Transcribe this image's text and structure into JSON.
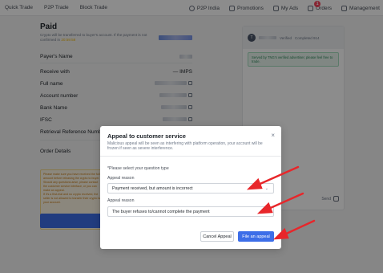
{
  "topnav": {
    "left": [
      "Quick Trade",
      "P2P Trade",
      "Block Trade"
    ],
    "right": [
      {
        "label": "P2P India",
        "icon": "globe-icon"
      },
      {
        "label": "Promotions",
        "icon": "gift-icon"
      },
      {
        "label": "My Ads",
        "icon": "list-icon"
      },
      {
        "label": "Orders",
        "icon": "order-icon",
        "badge": "1"
      },
      {
        "label": "Management",
        "icon": "more-icon"
      }
    ]
  },
  "order": {
    "status": "Paid",
    "subtitle": "Crypto will be transferred to buyer's account. If the payment is not confirmed in",
    "timer": "20:59:58",
    "payer_label": "Payer's Name",
    "receive_label": "Receive with",
    "receive_value": "IMPS",
    "fields": [
      "Full name",
      "Account number",
      "Bank Name",
      "IFSC",
      "Retrieval Reference Number"
    ],
    "details_label": "Order Details",
    "warning_lines": [
      "Please make sure you have received the full amount before releasing the crypto to buyer.",
      "Should any questions arise, please contact the customer service interface, or you can make an appeal.",
      "If it's a first-trial and no crypto received, the seller is not allowed to transfer their crypto to your account."
    ],
    "pay_button": "Payment r"
  },
  "chat": {
    "avatar_letter": "T",
    "verified": "Verified",
    "completed": "Completed 914",
    "notice": "Served by TNG's verified advertiser, please feel free to trade.",
    "send": "Send"
  },
  "modal": {
    "title": "Appeal to customer service",
    "close": "×",
    "description": "Malicious appeal will be seen as interfering with platform operation, your account will be frozen if seen as severe interference.",
    "question_prompt": "*Please select your question type",
    "reason1_label": "Appeal reason",
    "reason1_value": "Payment received, but amount is incorrect",
    "reason2_label": "Appeal reason",
    "reason2_value": "The buyer refuses to/cannot complete the payment",
    "cancel_label": "Cancel Appeal",
    "submit_label": "File an appeal"
  },
  "colors": {
    "accent": "#3d6ee8",
    "arrow": "#e8262a",
    "warning": "#f0b90b",
    "badge": "#f6465d"
  }
}
